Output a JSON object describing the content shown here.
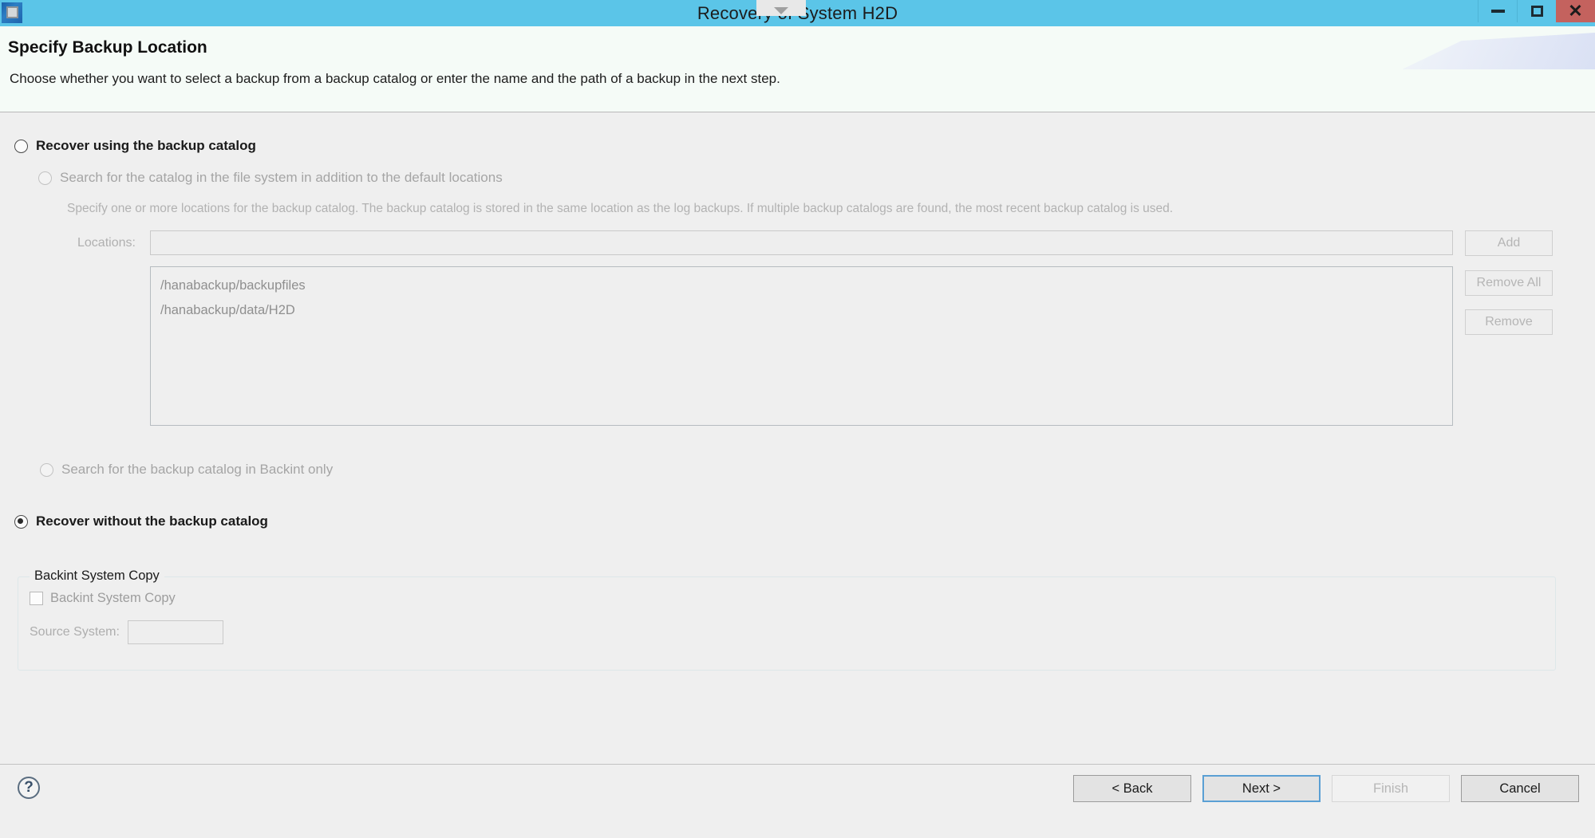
{
  "window": {
    "title": "Recovery of System H2D",
    "app_icon": "processor-chip-icon",
    "controls": {
      "minimize": "minimize-icon",
      "maximize": "maximize-icon",
      "close": "close-icon"
    },
    "overlay_chevron": "chevron-down-icon"
  },
  "header": {
    "title": "Specify Backup Location",
    "description": "Choose whether you want to select a backup from a backup catalog or enter the name and the path of a backup in the next step."
  },
  "options": {
    "recover_using_catalog": {
      "label": "Recover using the backup catalog",
      "checked": false,
      "enabled": true
    },
    "search_file_system": {
      "label": "Search for the catalog in the file system in addition to the default locations",
      "checked": false,
      "enabled": false
    },
    "catalog_hint": "Specify one or more locations for the backup catalog. The backup catalog is stored in the same location as the log backups. If multiple backup catalogs are found, the most recent backup catalog is used.",
    "search_backint_only": {
      "label": "Search for the backup catalog in Backint only",
      "checked": false,
      "enabled": false
    },
    "recover_without_catalog": {
      "label": "Recover without the backup catalog",
      "checked": true,
      "enabled": true
    }
  },
  "locations": {
    "label": "Locations:",
    "input_value": "",
    "input_placeholder": "",
    "items": [
      "/hanabackup/backupfiles",
      "/hanabackup/data/H2D"
    ],
    "buttons": {
      "add": "Add",
      "remove_all": "Remove All",
      "remove": "Remove"
    }
  },
  "backint_group": {
    "title": "Backint System Copy",
    "checkbox_label": "Backint System Copy",
    "checkbox_checked": false,
    "source_system_label": "Source System:",
    "source_system_value": ""
  },
  "footer": {
    "help_icon": "?",
    "buttons": {
      "back": "< Back",
      "next": "Next >",
      "finish": "Finish",
      "cancel": "Cancel"
    }
  },
  "colors": {
    "titlebar": "#5bc5e8",
    "close_button": "#c4625e",
    "body": "#efefef",
    "header": "#f5fbf7",
    "focus_border": "#5a9fd4"
  }
}
